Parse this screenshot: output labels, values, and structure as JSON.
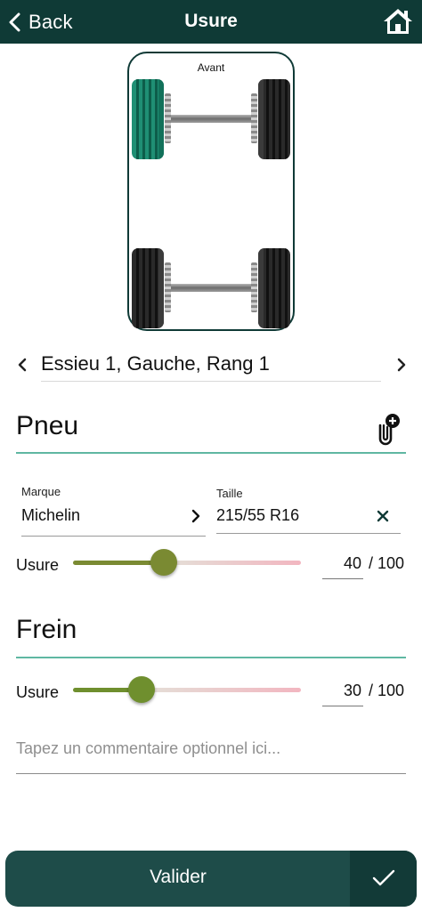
{
  "header": {
    "back_label": "Back",
    "title": "Usure"
  },
  "chassis": {
    "label": "Avant"
  },
  "position": {
    "label": "Essieu 1, Gauche, Rang 1"
  },
  "tire": {
    "title": "Pneu",
    "brand_label": "Marque",
    "brand_value": "Michelin",
    "size_label": "Taille",
    "size_value": "215/55 R16",
    "wear_label": "Usure",
    "wear_value": "40",
    "wear_max": "/ 100",
    "wear_fraction": 0.4
  },
  "brake": {
    "title": "Frein",
    "wear_label": "Usure",
    "wear_value": "30",
    "wear_max": "/ 100",
    "wear_fraction": 0.3
  },
  "comment": {
    "placeholder": "Tapez un commentaire optionnel ici..."
  },
  "footer": {
    "validate_label": "Valider"
  },
  "colors": {
    "header_bg": "#0f3a36",
    "accent": "#5fb7a2",
    "tire_selected": "#1f8f74",
    "slider_thumb_tire": "#7a8a32",
    "slider_thumb_brake": "#6f8f2e"
  },
  "icons": {
    "back": "chevron-left-icon",
    "home": "home-icon",
    "attach": "attachment-add-icon",
    "next": "chevron-right-icon",
    "clear": "close-icon",
    "validate": "check-icon"
  }
}
